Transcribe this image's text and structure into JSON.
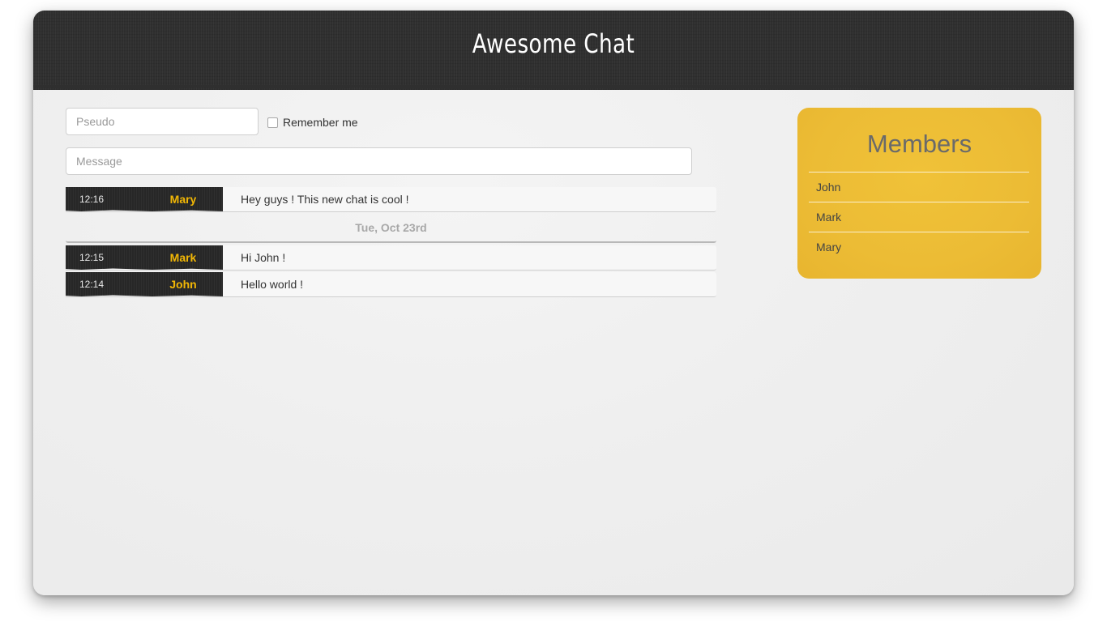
{
  "header": {
    "title": "Awesome Chat"
  },
  "form": {
    "pseudo_placeholder": "Pseudo",
    "remember_label": "Remember me",
    "message_placeholder": "Message"
  },
  "messages": [
    {
      "time": "12:16",
      "author": "Mary",
      "text": "Hey guys ! This new chat is cool !"
    },
    {
      "separator": "Tue, Oct 23rd"
    },
    {
      "time": "12:15",
      "author": "Mark",
      "text": "Hi John !"
    },
    {
      "time": "12:14",
      "author": "John",
      "text": "Hello world !"
    }
  ],
  "members": {
    "title": "Members",
    "items": [
      "John",
      "Mark",
      "Mary"
    ]
  },
  "colors": {
    "header_bg": "#2f2f2f",
    "author_accent": "#f2b705",
    "members_panel": "#ecbc35",
    "page_bg": "#efefef"
  }
}
